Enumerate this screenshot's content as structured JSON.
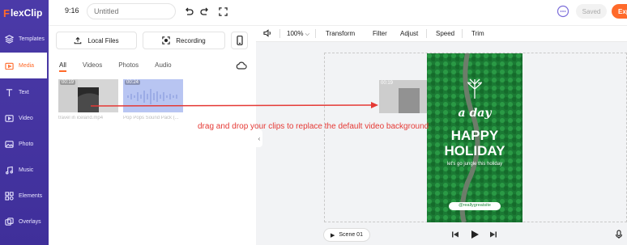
{
  "app": {
    "logo_prefix": "F",
    "logo_text": "lexClip"
  },
  "sidebar": {
    "items": [
      {
        "label": "Templates",
        "icon": "layers-icon"
      },
      {
        "label": "Media",
        "icon": "media-folder-icon",
        "active": true
      },
      {
        "label": "Text",
        "icon": "text-icon"
      },
      {
        "label": "Video",
        "icon": "video-icon"
      },
      {
        "label": "Photo",
        "icon": "photo-icon"
      },
      {
        "label": "Music",
        "icon": "music-icon"
      },
      {
        "label": "Elements",
        "icon": "elements-icon"
      },
      {
        "label": "Overlays",
        "icon": "overlays-icon"
      }
    ]
  },
  "topbar": {
    "aspect_ratio": "9:16",
    "title_placeholder": "Untitled",
    "saved_label": "Saved",
    "export_label": "Exp"
  },
  "media_panel": {
    "local_files_label": "Local Files",
    "recording_label": "Recording",
    "tabs": [
      "All",
      "Videos",
      "Photos",
      "Audio"
    ],
    "items": [
      {
        "duration": "00:19",
        "caption": "travel in iceland.mp4"
      },
      {
        "duration": "00:24",
        "caption": "Pop Pops Sound Pack (..."
      }
    ]
  },
  "editor_toolbar": {
    "zoom": "100%",
    "items": [
      "Transform",
      "Filter",
      "Adjust",
      "Speed",
      "Trim"
    ]
  },
  "canvas": {
    "ghost_duration": "00:19",
    "poster": {
      "line1": "a day",
      "line2": "HAPPY",
      "line3": "HOLIDAY",
      "tagline": "let's go jungle this holiday",
      "handle": "@reallygreatsite"
    }
  },
  "annotation": "drag and drop your clips to replace the default video background",
  "playback": {
    "scene_label": "Scene 01"
  },
  "colors": {
    "accent": "#ff6a2a",
    "sidebar": "#4b3aa8",
    "annotation": "#e53935",
    "poster_green": "#1f8a3c"
  }
}
